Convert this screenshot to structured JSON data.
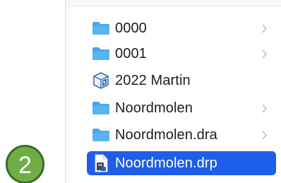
{
  "colors": {
    "folder": "#5ab4ef",
    "selection": "#1f5ee8",
    "badge_fill": "#70ad47",
    "badge_border": "#3c6b25"
  },
  "badge": {
    "label": "2"
  },
  "file_list": {
    "items": [
      {
        "name": "0000",
        "icon": "folder-icon",
        "has_children": true,
        "selected": false
      },
      {
        "name": "0001",
        "icon": "folder-icon",
        "has_children": true,
        "selected": false
      },
      {
        "name": "2022 Martin",
        "icon": "app-icon",
        "has_children": false,
        "selected": false
      },
      {
        "name": "Noordmolen",
        "icon": "folder-icon",
        "has_children": true,
        "selected": false
      },
      {
        "name": "Noordmolen.dra",
        "icon": "folder-icon",
        "has_children": true,
        "selected": false
      },
      {
        "name": "Noordmolen.drp",
        "icon": "document-icon",
        "has_children": false,
        "selected": true
      }
    ]
  }
}
